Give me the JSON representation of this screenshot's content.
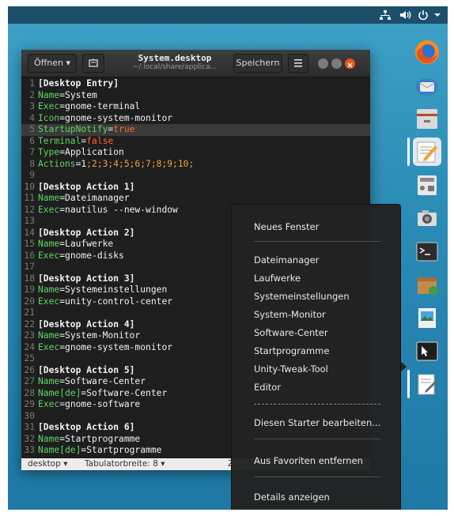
{
  "topbar": {
    "icons": [
      "network-icon",
      "volume-icon",
      "power-icon",
      "chevron-down-icon"
    ]
  },
  "dock": {
    "items": [
      "firefox-icon",
      "thunderbird-icon",
      "files-icon",
      "text-editor-icon",
      "calculator-icon",
      "camera-icon",
      "terminal-icon",
      "archive-icon",
      "image-viewer-icon",
      "system-launcher-icon",
      "document-icon"
    ]
  },
  "editor": {
    "open_label": "Öffnen",
    "save_label": "Speichern",
    "title": "System.desktop",
    "subtitle": "~/.local/share/applica...",
    "lines": [
      {
        "n": "1",
        "parts": [
          {
            "t": "[Desktop Entry]",
            "c": "sec"
          }
        ]
      },
      {
        "n": "2",
        "parts": [
          {
            "t": "Name",
            "c": "key"
          },
          {
            "t": "=System",
            "c": "val"
          }
        ]
      },
      {
        "n": "3",
        "parts": [
          {
            "t": "Exec",
            "c": "key"
          },
          {
            "t": "=gnome-terminal",
            "c": "val"
          }
        ]
      },
      {
        "n": "4",
        "parts": [
          {
            "t": "Icon",
            "c": "key"
          },
          {
            "t": "=gnome-system-monitor",
            "c": "val"
          }
        ]
      },
      {
        "n": "5",
        "parts": [
          {
            "t": "StartupNotify",
            "c": "key"
          },
          {
            "t": "=",
            "c": "val"
          },
          {
            "t": "true",
            "c": "valo"
          }
        ],
        "hl": true
      },
      {
        "n": "6",
        "parts": [
          {
            "t": "Terminal",
            "c": "key"
          },
          {
            "t": "=",
            "c": "val"
          },
          {
            "t": "false",
            "c": "valo"
          }
        ]
      },
      {
        "n": "7",
        "parts": [
          {
            "t": "Type",
            "c": "key"
          },
          {
            "t": "=Application",
            "c": "val"
          }
        ]
      },
      {
        "n": "8",
        "parts": [
          {
            "t": "Actions",
            "c": "key"
          },
          {
            "t": "=1",
            "c": "val"
          },
          {
            "t": ";2;3;4;5;6;7;8;9;10;",
            "c": "vals"
          }
        ]
      },
      {
        "n": "9",
        "parts": []
      },
      {
        "n": "10",
        "parts": [
          {
            "t": "[Desktop Action 1]",
            "c": "sec"
          }
        ]
      },
      {
        "n": "11",
        "parts": [
          {
            "t": "Name",
            "c": "key"
          },
          {
            "t": "=Dateimanager",
            "c": "val"
          }
        ]
      },
      {
        "n": "12",
        "parts": [
          {
            "t": "Exec",
            "c": "key"
          },
          {
            "t": "=nautilus --new-window",
            "c": "val"
          }
        ]
      },
      {
        "n": "13",
        "parts": []
      },
      {
        "n": "14",
        "parts": [
          {
            "t": "[Desktop Action 2]",
            "c": "sec"
          }
        ]
      },
      {
        "n": "15",
        "parts": [
          {
            "t": "Name",
            "c": "key"
          },
          {
            "t": "=Laufwerke",
            "c": "val"
          }
        ]
      },
      {
        "n": "16",
        "parts": [
          {
            "t": "Exec",
            "c": "key"
          },
          {
            "t": "=gnome-disks",
            "c": "val"
          }
        ]
      },
      {
        "n": "17",
        "parts": []
      },
      {
        "n": "18",
        "parts": [
          {
            "t": "[Desktop Action 3]",
            "c": "sec"
          }
        ]
      },
      {
        "n": "19",
        "parts": [
          {
            "t": "Name",
            "c": "key"
          },
          {
            "t": "=Systemeinstellungen",
            "c": "val"
          }
        ]
      },
      {
        "n": "20",
        "parts": [
          {
            "t": "Exec",
            "c": "key"
          },
          {
            "t": "=unity-control-center",
            "c": "val"
          }
        ]
      },
      {
        "n": "21",
        "parts": []
      },
      {
        "n": "22",
        "parts": [
          {
            "t": "[Desktop Action 4]",
            "c": "sec"
          }
        ]
      },
      {
        "n": "23",
        "parts": [
          {
            "t": "Name",
            "c": "key"
          },
          {
            "t": "=System-Monitor",
            "c": "val"
          }
        ]
      },
      {
        "n": "24",
        "parts": [
          {
            "t": "Exec",
            "c": "key"
          },
          {
            "t": "=gnome-system-monitor",
            "c": "val"
          }
        ]
      },
      {
        "n": "25",
        "parts": []
      },
      {
        "n": "26",
        "parts": [
          {
            "t": "[Desktop Action 5]",
            "c": "sec"
          }
        ]
      },
      {
        "n": "27",
        "parts": [
          {
            "t": "Name",
            "c": "key"
          },
          {
            "t": "=Software-Center",
            "c": "val"
          }
        ]
      },
      {
        "n": "28",
        "parts": [
          {
            "t": "Name[de]",
            "c": "key"
          },
          {
            "t": "=Software-Center",
            "c": "val"
          }
        ]
      },
      {
        "n": "29",
        "parts": [
          {
            "t": "Exec",
            "c": "key"
          },
          {
            "t": "=gnome-software",
            "c": "val"
          }
        ]
      },
      {
        "n": "30",
        "parts": []
      },
      {
        "n": "31",
        "parts": [
          {
            "t": "[Desktop Action 6]",
            "c": "sec"
          }
        ]
      },
      {
        "n": "32",
        "parts": [
          {
            "t": "Name",
            "c": "key"
          },
          {
            "t": "=Startprogramme",
            "c": "val"
          }
        ]
      },
      {
        "n": "33",
        "parts": [
          {
            "t": "Name[de]",
            "c": "key"
          },
          {
            "t": "=Startprogramme",
            "c": "val"
          }
        ]
      }
    ],
    "status_syntax": "desktop",
    "status_tab": "Tabulatorbreite: 8",
    "status_pos": "Z."
  },
  "menu": {
    "new_window": "Neues Fenster",
    "actions": [
      "Dateimanager",
      "Laufwerke",
      "Systemeinstellungen",
      "System-Monitor",
      "Software-Center",
      "Startprogramme",
      "Unity-Tweak-Tool",
      "Editor"
    ],
    "edit_launcher": "Diesen Starter bearbeiten...",
    "remove_favorites": "Aus Favoriten entfernen",
    "details": "Details anzeigen"
  },
  "colors": {
    "accent_close": "#e95420",
    "desktop": "#2b8cb6"
  }
}
